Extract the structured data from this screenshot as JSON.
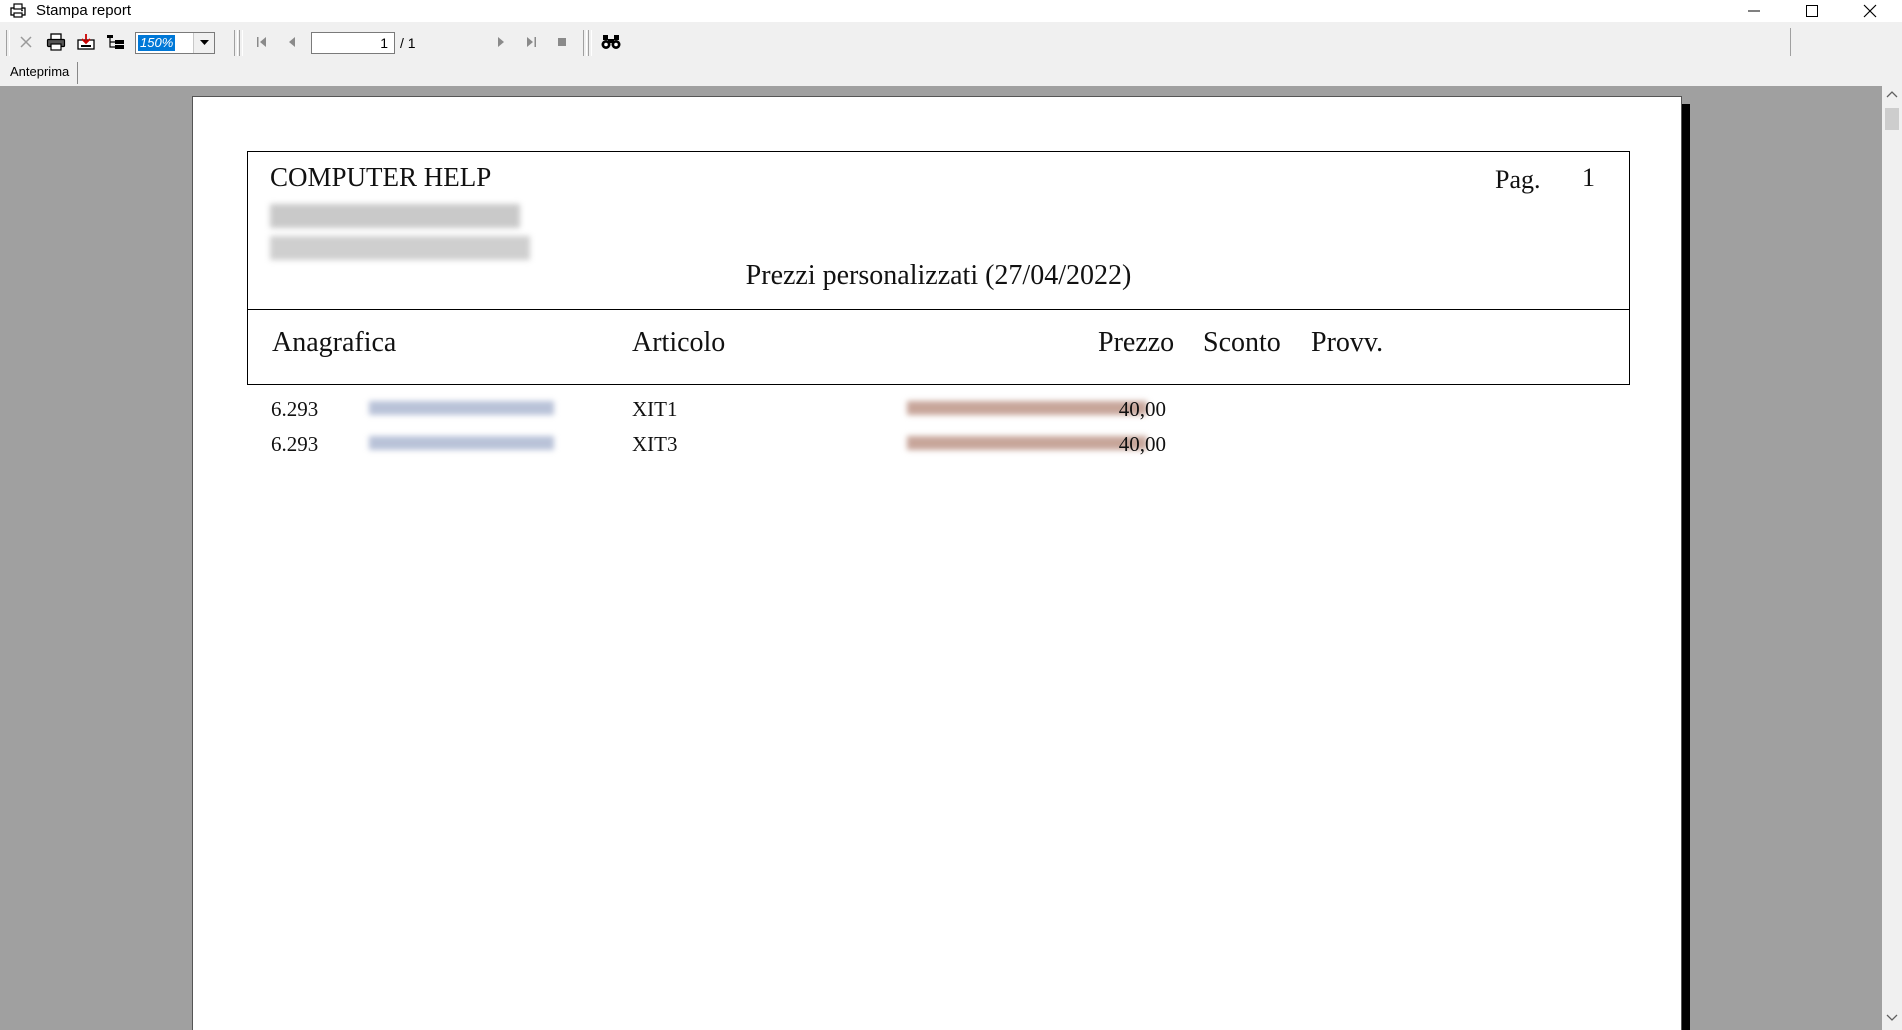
{
  "window": {
    "title": "Stampa report"
  },
  "toolbar": {
    "zoom_value": "150%",
    "page_current": "1",
    "page_total": "/ 1",
    "icons": [
      "close-icon",
      "print-icon",
      "export-icon",
      "tree-icon",
      "first-page-icon",
      "prev-page-icon",
      "next-page-icon",
      "last-page-icon",
      "stop-icon",
      "search-binoculars-icon"
    ]
  },
  "tabs": [
    {
      "label": "Anteprima"
    }
  ],
  "report": {
    "company": "COMPUTER HELP",
    "page_label": "Pag.",
    "page_number": "1",
    "title": "Prezzi personalizzati (27/04/2022)",
    "columns": {
      "anagrafica": "Anagrafica",
      "articolo": "Articolo",
      "prezzo": "Prezzo",
      "sconto": "Sconto",
      "provv": "Provv."
    },
    "rows": [
      {
        "code": "6.293",
        "article": "XIT1",
        "price": "40,00"
      },
      {
        "code": "6.293",
        "article": "XIT3",
        "price": "40,00"
      }
    ]
  },
  "colors": {
    "preview_bg": "#a0a0a0",
    "selection": "#0078d7"
  }
}
